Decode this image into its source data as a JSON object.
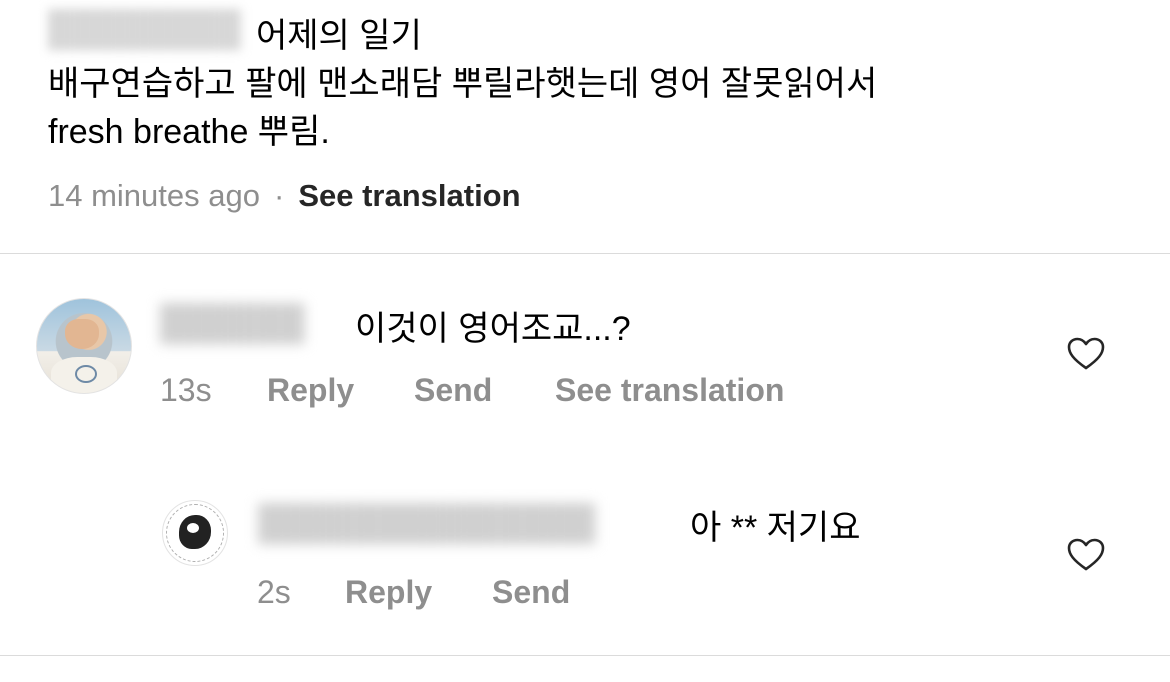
{
  "post": {
    "title": "어제의 일기",
    "body_lines": [
      "배구연습하고 팔에 맨소래담 뿌릴라햇는데 영어 잘못읽어서",
      "fresh breathe 뿌림."
    ],
    "time": "14 minutes ago",
    "separator": "·",
    "see_translation": "See translation"
  },
  "comments": [
    {
      "text": "이것이 영어조교...?",
      "time": "13s",
      "reply_label": "Reply",
      "send_label": "Send",
      "see_translation": "See translation"
    },
    {
      "text": "아 ** 저기요",
      "time": "2s",
      "reply_label": "Reply",
      "send_label": "Send"
    }
  ],
  "icons": {
    "like": "heart-outline-icon"
  },
  "colors": {
    "secondary_text": "#8e8e8e",
    "divider": "#dbdbdb",
    "primary_text": "#000000"
  }
}
